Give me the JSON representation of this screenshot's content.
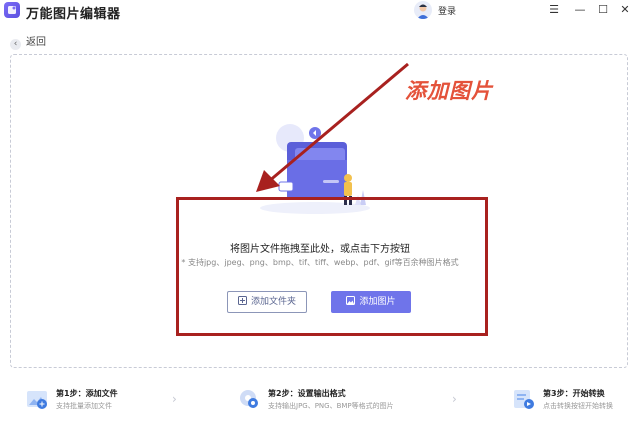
{
  "app": {
    "title": "万能图片编辑器",
    "login_label": "登录",
    "window_controls": {
      "menu": "☰",
      "minimize": "—",
      "maximize": "☐",
      "close": "✕"
    }
  },
  "nav": {
    "back_label": "返回"
  },
  "dropzone": {
    "callout": "添加图片",
    "main_text": "将图片文件拖拽至此处，或点击下方按钮",
    "sub_text": "* 支持jpg、jpeg、png、bmp、tif、tiff、webp、pdf、gif等百余种图片格式",
    "folder_button": "添加文件夹",
    "image_button": "添加图片"
  },
  "steps": [
    {
      "title": "第1步：添加文件",
      "desc": "支持批量添加文件"
    },
    {
      "title": "第2步：设置输出格式",
      "desc": "支持输出JPG、PNG、BMP等格式的图片"
    },
    {
      "title": "第3步：开始转换",
      "desc": "点击转换按钮开始转换"
    }
  ],
  "colors": {
    "accent": "#6f74ea",
    "annotation_red": "#a8211f",
    "callout_red": "#e4523a"
  },
  "icons": [
    "app-logo-icon",
    "avatar-icon",
    "back-icon",
    "folder-plus-icon",
    "image-icon",
    "add-file-step-icon",
    "settings-gear-icon",
    "convert-step-icon",
    "arrow-right-icon"
  ]
}
